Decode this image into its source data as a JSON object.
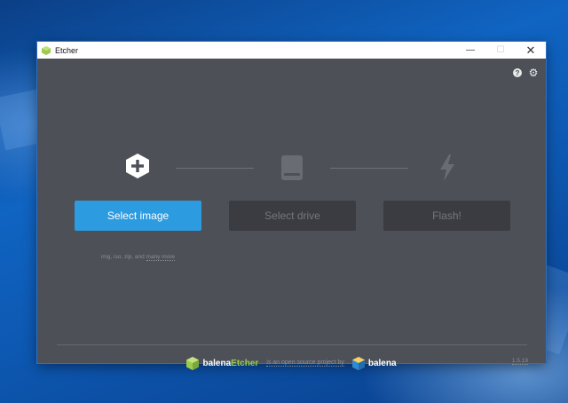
{
  "window": {
    "title": "Etcher"
  },
  "header_icons": {
    "help": "?",
    "settings": "⚙"
  },
  "steps": [
    {
      "icon": "plus-hexagon-icon",
      "button_label": "Select image",
      "state": "active"
    },
    {
      "icon": "drive-icon",
      "button_label": "Select drive",
      "state": "disabled"
    },
    {
      "icon": "lightning-icon",
      "button_label": "Flash!",
      "state": "disabled"
    }
  ],
  "image_formats": {
    "text": "img, iso, zip, and",
    "more_link": "many more"
  },
  "footer": {
    "brand_balena": "balena",
    "brand_etcher": "Etcher",
    "oss_text": "is an open source project by",
    "company": "balena",
    "version": "1.5.19"
  },
  "colors": {
    "window_bg": "#4d5057",
    "primary": "#2c9be0",
    "etcher_green": "#9bcc4b"
  }
}
